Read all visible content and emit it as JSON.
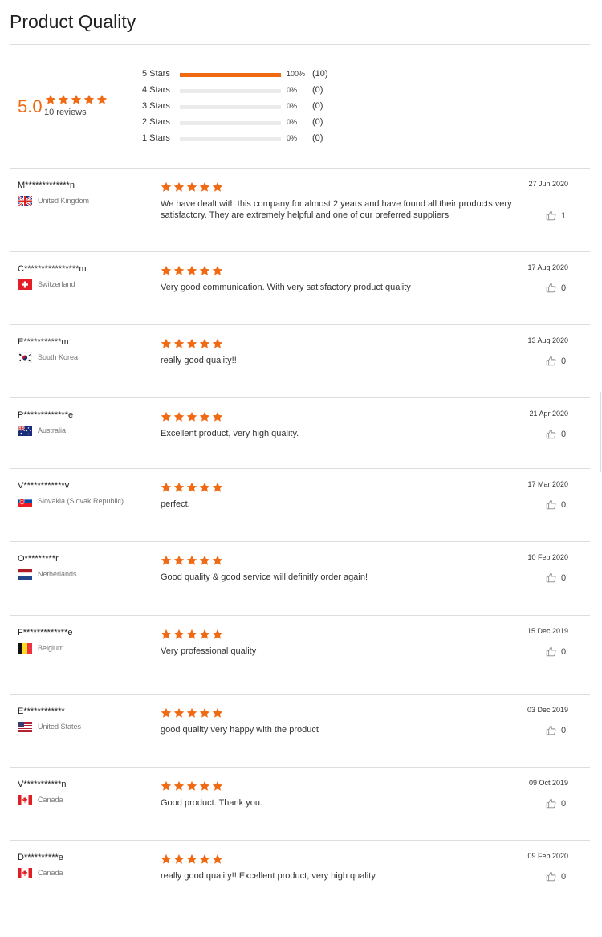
{
  "page": {
    "title": "Product Quality"
  },
  "summary": {
    "average": "5.0",
    "review_count_label": "10 reviews",
    "accent_color": "#f06a14",
    "distribution": [
      {
        "label": "5  Stars",
        "percent_label": "100%",
        "count_label": "(10)",
        "fraction": 1.0
      },
      {
        "label": "4  Stars",
        "percent_label": "0%",
        "count_label": "(0)",
        "fraction": 0
      },
      {
        "label": "3  Stars",
        "percent_label": "0%",
        "count_label": "(0)",
        "fraction": 0
      },
      {
        "label": "2  Stars",
        "percent_label": "0%",
        "count_label": "(0)",
        "fraction": 0
      },
      {
        "label": "1  Stars",
        "percent_label": "0%",
        "count_label": "(0)",
        "fraction": 0
      }
    ]
  },
  "reviews": [
    {
      "name": "M*************n",
      "country": "United Kingdom",
      "flag_icon": "flag-uk-icon",
      "rating": 5,
      "text": "We have dealt with this company for almost 2 years and have found all their products very satisfactory. They are extremely helpful and one of our preferred suppliers",
      "date": "27 Jun 2020",
      "likes": "1"
    },
    {
      "name": "C****************m",
      "country": "Switzerland",
      "flag_icon": "flag-switzerland-icon",
      "rating": 5,
      "text": "Very good communication. With very satisfactory product quality",
      "date": "17 Aug 2020",
      "likes": "0"
    },
    {
      "name": "E***********m",
      "country": "South Korea",
      "flag_icon": "flag-south-korea-icon",
      "rating": 5,
      "text": "really good quality!!",
      "date": "13 Aug 2020",
      "likes": "0"
    },
    {
      "name": "P*************e",
      "country": "Australia",
      "flag_icon": "flag-australia-icon",
      "rating": 5,
      "text": "Excellent product, very high quality.",
      "date": "21 Apr 2020",
      "likes": "0"
    },
    {
      "name": "V************v",
      "country": "Slovakia (Slovak Republic)",
      "flag_icon": "flag-slovakia-icon",
      "rating": 5,
      "text": "perfect.",
      "date": "17 Mar 2020",
      "likes": "0"
    },
    {
      "name": "O*********r",
      "country": "Netherlands",
      "flag_icon": "flag-netherlands-icon",
      "rating": 5,
      "text": "Good quality & good service will definitly order again!",
      "date": "10 Feb 2020",
      "likes": "0"
    },
    {
      "name": "F*************e",
      "country": "Belgium",
      "flag_icon": "flag-belgium-icon",
      "rating": 5,
      "text": "Very professional quality",
      "date": "15 Dec 2019",
      "likes": "0"
    },
    {
      "name": "E************",
      "country": "United States",
      "flag_icon": "flag-usa-icon",
      "rating": 5,
      "text": "good quality very happy with the product",
      "date": "03 Dec 2019",
      "likes": "0"
    },
    {
      "name": "V***********n",
      "country": "Canada",
      "flag_icon": "flag-canada-icon",
      "rating": 5,
      "text": "Good product. Thank you.",
      "date": "09 Oct 2019",
      "likes": "0"
    },
    {
      "name": "D**********e",
      "country": "Canada",
      "flag_icon": "flag-canada-icon",
      "rating": 5,
      "text": "really good quality!!  Excellent product, very high quality.",
      "date": "09 Feb 2020",
      "likes": "0"
    }
  ]
}
